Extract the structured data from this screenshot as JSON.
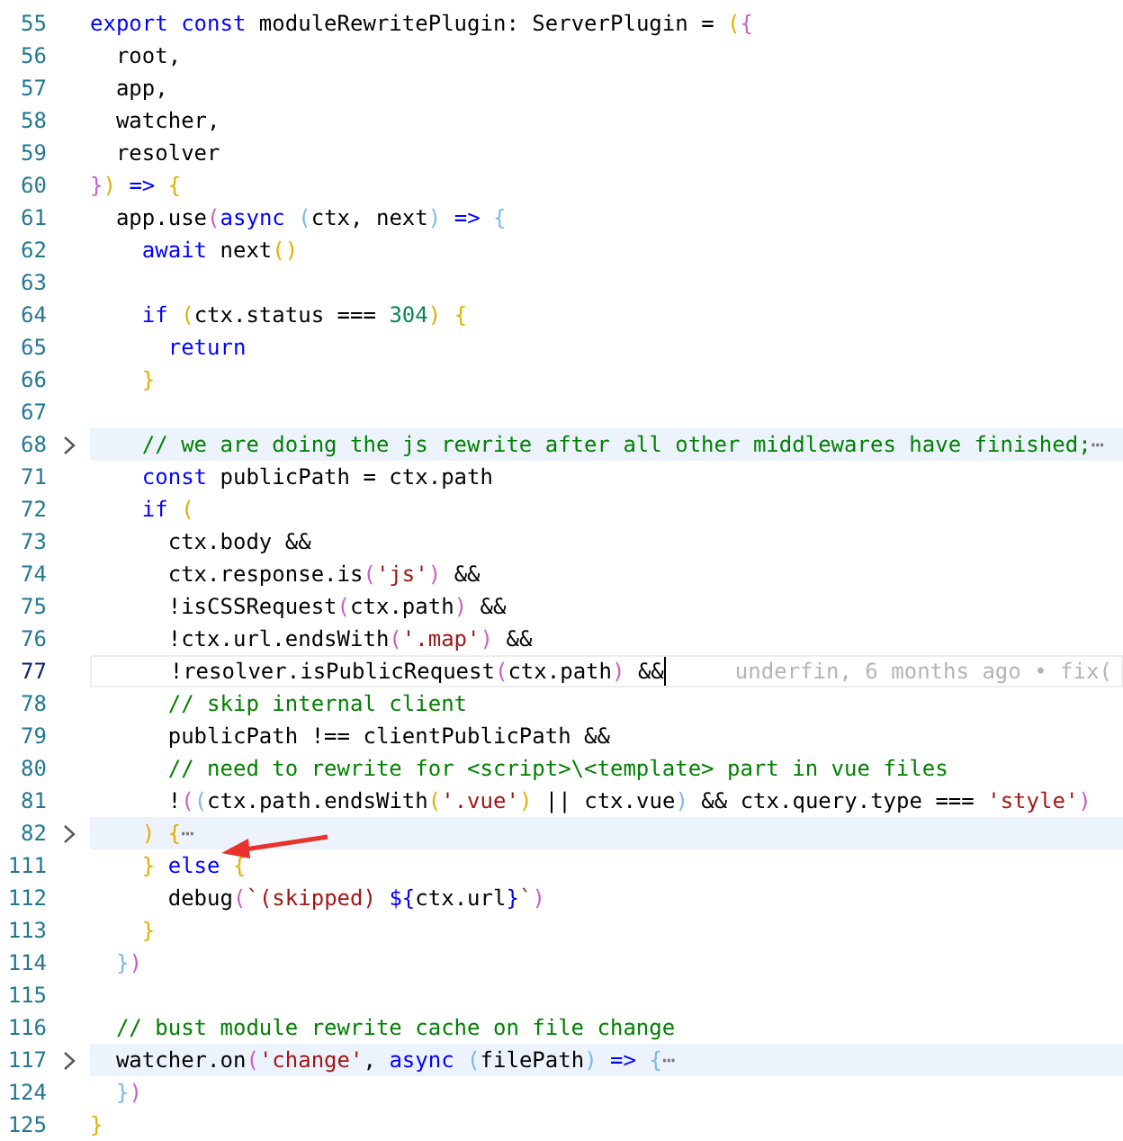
{
  "editor": {
    "lines": [
      {
        "number": "55",
        "folded": false,
        "tokens": [
          {
            "kind": "keyword",
            "text": "export "
          },
          {
            "kind": "keyword",
            "text": "const"
          },
          {
            "kind": "plain",
            "text": " moduleRewritePlugin: ServerPlugin = "
          },
          {
            "kind": "bracket1",
            "text": "("
          },
          {
            "kind": "bracket2",
            "text": "{"
          }
        ]
      },
      {
        "number": "56",
        "folded": false,
        "tokens": [
          {
            "kind": "plain",
            "text": "  root,"
          }
        ]
      },
      {
        "number": "57",
        "folded": false,
        "tokens": [
          {
            "kind": "plain",
            "text": "  app,"
          }
        ]
      },
      {
        "number": "58",
        "folded": false,
        "tokens": [
          {
            "kind": "plain",
            "text": "  watcher,"
          }
        ]
      },
      {
        "number": "59",
        "folded": false,
        "tokens": [
          {
            "kind": "plain",
            "text": "  resolver"
          }
        ]
      },
      {
        "number": "60",
        "folded": false,
        "tokens": [
          {
            "kind": "bracket2",
            "text": "}"
          },
          {
            "kind": "bracket1",
            "text": ")"
          },
          {
            "kind": "keyword",
            "text": " => "
          },
          {
            "kind": "bracket1",
            "text": "{"
          }
        ]
      },
      {
        "number": "61",
        "folded": false,
        "tokens": [
          {
            "kind": "plain",
            "text": "  app.use"
          },
          {
            "kind": "bracket2",
            "text": "("
          },
          {
            "kind": "keyword",
            "text": "async "
          },
          {
            "kind": "bracket3",
            "text": "("
          },
          {
            "kind": "plain",
            "text": "ctx, next"
          },
          {
            "kind": "bracket3",
            "text": ")"
          },
          {
            "kind": "keyword",
            "text": " => "
          },
          {
            "kind": "bracket3",
            "text": "{"
          }
        ]
      },
      {
        "number": "62",
        "folded": false,
        "tokens": [
          {
            "kind": "keyword",
            "text": "    await"
          },
          {
            "kind": "plain",
            "text": " next"
          },
          {
            "kind": "bracket1",
            "text": "()"
          }
        ]
      },
      {
        "number": "63",
        "folded": false
      },
      {
        "number": "64",
        "folded": false,
        "tokens": [
          {
            "kind": "keyword",
            "text": "    if "
          },
          {
            "kind": "bracket1",
            "text": "("
          },
          {
            "kind": "plain",
            "text": "ctx.status === "
          },
          {
            "kind": "number",
            "text": "304"
          },
          {
            "kind": "bracket1",
            "text": ")"
          },
          {
            "kind": "bracket1",
            "text": " {"
          }
        ]
      },
      {
        "number": "65",
        "folded": false,
        "tokens": [
          {
            "kind": "keyword",
            "text": "      return"
          }
        ]
      },
      {
        "number": "66",
        "folded": false,
        "tokens": [
          {
            "kind": "bracket1",
            "text": "    }"
          }
        ]
      },
      {
        "number": "67",
        "folded": false
      },
      {
        "number": "68",
        "folded": true,
        "tokens": [
          {
            "kind": "comment",
            "text": "    // we are doing the js rewrite after all other middlewares have finished;"
          },
          {
            "kind": "ellipsis",
            "text": "⋯"
          }
        ]
      },
      {
        "number": "71",
        "folded": false,
        "tokens": [
          {
            "kind": "keyword",
            "text": "    const"
          },
          {
            "kind": "plain",
            "text": " publicPath = ctx.path"
          }
        ]
      },
      {
        "number": "72",
        "folded": false,
        "tokens": [
          {
            "kind": "keyword",
            "text": "    if "
          },
          {
            "kind": "bracket1",
            "text": "("
          }
        ]
      },
      {
        "number": "73",
        "folded": false,
        "tokens": [
          {
            "kind": "plain",
            "text": "      ctx.body &&"
          }
        ]
      },
      {
        "number": "74",
        "folded": false,
        "tokens": [
          {
            "kind": "plain",
            "text": "      ctx.response.is"
          },
          {
            "kind": "bracket2",
            "text": "("
          },
          {
            "kind": "string",
            "text": "'js'"
          },
          {
            "kind": "bracket2",
            "text": ")"
          },
          {
            "kind": "plain",
            "text": " &&"
          }
        ]
      },
      {
        "number": "75",
        "folded": false,
        "tokens": [
          {
            "kind": "plain",
            "text": "      !isCSSRequest"
          },
          {
            "kind": "bracket2",
            "text": "("
          },
          {
            "kind": "plain",
            "text": "ctx.path"
          },
          {
            "kind": "bracket2",
            "text": ")"
          },
          {
            "kind": "plain",
            "text": " &&"
          }
        ]
      },
      {
        "number": "76",
        "folded": false,
        "tokens": [
          {
            "kind": "plain",
            "text": "      !ctx.url.endsWith"
          },
          {
            "kind": "bracket2",
            "text": "("
          },
          {
            "kind": "string",
            "text": "'.map'"
          },
          {
            "kind": "bracket2",
            "text": ")"
          },
          {
            "kind": "plain",
            "text": " &&"
          }
        ]
      },
      {
        "number": "77",
        "folded": false,
        "current": true,
        "blame": "underfin, 6 months ago • fix(",
        "tokens": [
          {
            "kind": "plain",
            "text": "      !resolver.isPublicRequest"
          },
          {
            "kind": "bracket2",
            "text": "("
          },
          {
            "kind": "plain",
            "text": "ctx.path"
          },
          {
            "kind": "bracket2",
            "text": ")"
          },
          {
            "kind": "plain",
            "text": " &&"
          }
        ]
      },
      {
        "number": "78",
        "folded": false,
        "tokens": [
          {
            "kind": "comment",
            "text": "      // skip internal client"
          }
        ]
      },
      {
        "number": "79",
        "folded": false,
        "tokens": [
          {
            "kind": "plain",
            "text": "      publicPath !== clientPublicPath &&"
          }
        ]
      },
      {
        "number": "80",
        "folded": false,
        "tokens": [
          {
            "kind": "comment",
            "text": "      // need to rewrite for <script>\\<template> part in vue files"
          }
        ]
      },
      {
        "number": "81",
        "folded": false,
        "tokens": [
          {
            "kind": "plain",
            "text": "      !"
          },
          {
            "kind": "bracket2",
            "text": "("
          },
          {
            "kind": "bracket3",
            "text": "("
          },
          {
            "kind": "plain",
            "text": "ctx.path.endsWith"
          },
          {
            "kind": "bracket1",
            "text": "("
          },
          {
            "kind": "string",
            "text": "'.vue'"
          },
          {
            "kind": "bracket1",
            "text": ")"
          },
          {
            "kind": "plain",
            "text": " || ctx.vue"
          },
          {
            "kind": "bracket3",
            "text": ")"
          },
          {
            "kind": "plain",
            "text": " && ctx.query.type === "
          },
          {
            "kind": "string",
            "text": "'style'"
          },
          {
            "kind": "bracket2",
            "text": ")"
          }
        ]
      },
      {
        "number": "82",
        "folded": true,
        "tokens": [
          {
            "kind": "bracket1",
            "text": "    )"
          },
          {
            "kind": "bracket1",
            "text": " {"
          },
          {
            "kind": "ellipsis",
            "text": "⋯"
          }
        ]
      },
      {
        "number": "111",
        "folded": false,
        "tokens": [
          {
            "kind": "bracket1",
            "text": "    }"
          },
          {
            "kind": "keyword",
            "text": " else "
          },
          {
            "kind": "bracket1",
            "text": "{"
          }
        ]
      },
      {
        "number": "112",
        "folded": false,
        "tokens": [
          {
            "kind": "plain",
            "text": "      debug"
          },
          {
            "kind": "bracket2",
            "text": "("
          },
          {
            "kind": "string",
            "text": "`(skipped) "
          },
          {
            "kind": "keyword",
            "text": "${"
          },
          {
            "kind": "plain",
            "text": "ctx.url"
          },
          {
            "kind": "keyword",
            "text": "}"
          },
          {
            "kind": "string",
            "text": "`"
          },
          {
            "kind": "bracket2",
            "text": ")"
          }
        ]
      },
      {
        "number": "113",
        "folded": false,
        "tokens": [
          {
            "kind": "bracket1",
            "text": "    }"
          }
        ]
      },
      {
        "number": "114",
        "folded": false,
        "tokens": [
          {
            "kind": "bracket3",
            "text": "  }"
          },
          {
            "kind": "bracket2",
            "text": ")"
          }
        ]
      },
      {
        "number": "115",
        "folded": false
      },
      {
        "number": "116",
        "folded": false,
        "tokens": [
          {
            "kind": "comment",
            "text": "  // bust module rewrite cache on file change"
          }
        ]
      },
      {
        "number": "117",
        "folded": true,
        "tokens": [
          {
            "kind": "plain",
            "text": "  watcher.on"
          },
          {
            "kind": "bracket2",
            "text": "("
          },
          {
            "kind": "string",
            "text": "'change'"
          },
          {
            "kind": "plain",
            "text": ", "
          },
          {
            "kind": "keyword",
            "text": "async "
          },
          {
            "kind": "bracket3",
            "text": "("
          },
          {
            "kind": "plain",
            "text": "filePath"
          },
          {
            "kind": "bracket3",
            "text": ")"
          },
          {
            "kind": "keyword",
            "text": " => "
          },
          {
            "kind": "bracket3",
            "text": "{"
          },
          {
            "kind": "ellipsis",
            "text": "⋯"
          }
        ]
      },
      {
        "number": "124",
        "folded": false,
        "tokens": [
          {
            "kind": "bracket3",
            "text": "  }"
          },
          {
            "kind": "bracket2",
            "text": ")"
          }
        ]
      },
      {
        "number": "125",
        "folded": false,
        "tokens": [
          {
            "kind": "bracket1",
            "text": "}"
          }
        ]
      }
    ]
  }
}
